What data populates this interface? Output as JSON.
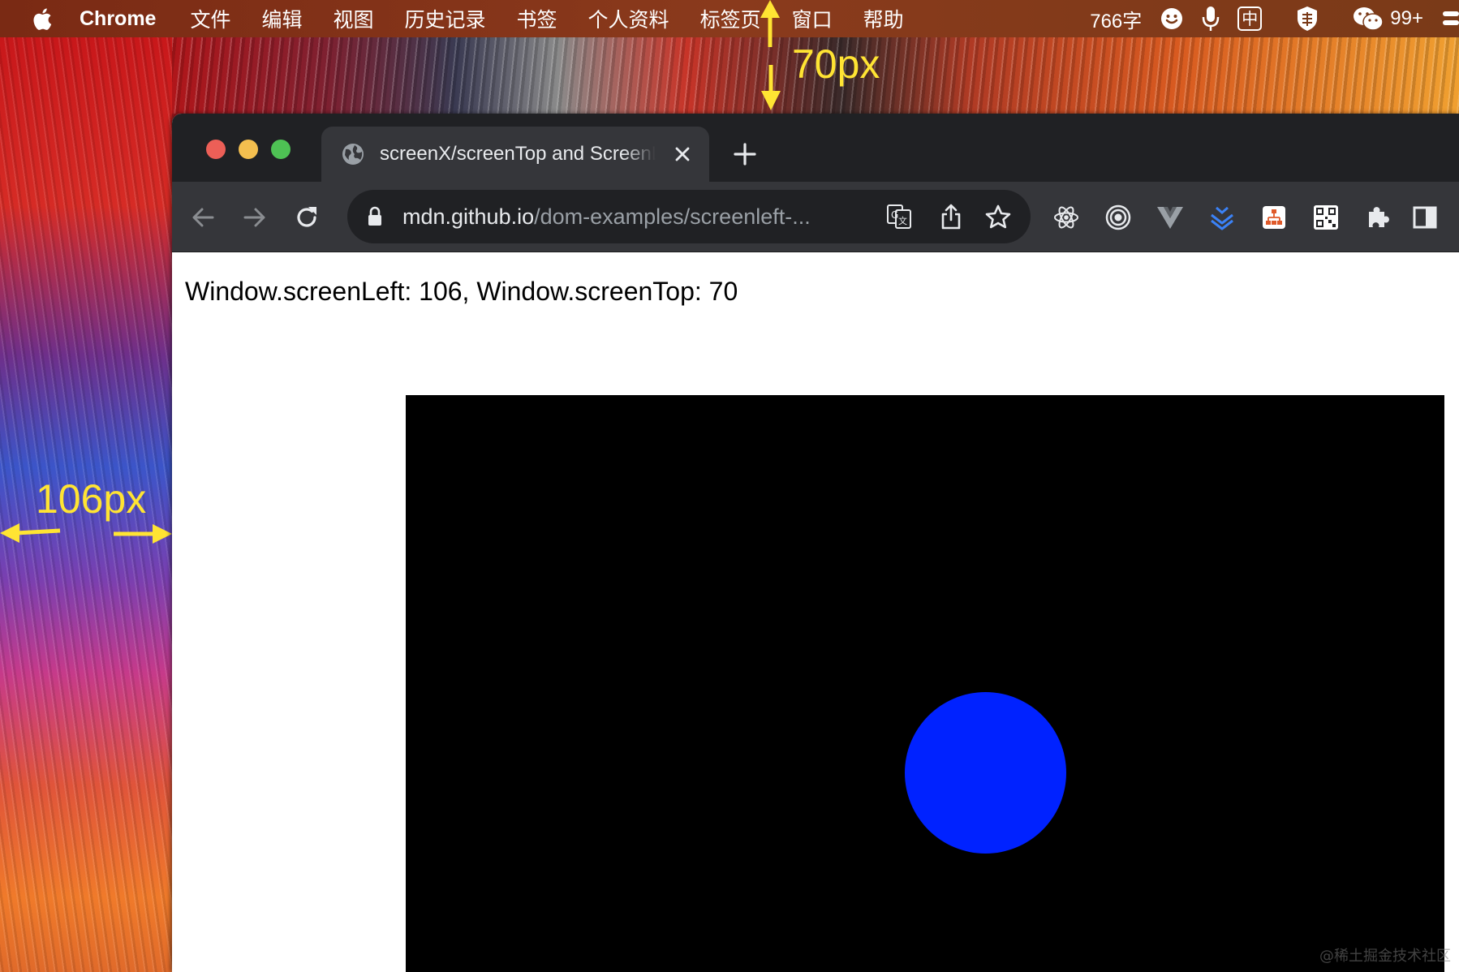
{
  "menubar": {
    "app_name": "Chrome",
    "items": [
      "文件",
      "编辑",
      "视图",
      "历史记录",
      "书签",
      "个人资料",
      "标签页",
      "窗口",
      "帮助"
    ],
    "word_count": "766字",
    "ime_label": "中",
    "wechat_badge": "99+"
  },
  "annotations": {
    "top_gap": "70px",
    "left_gap": "106px",
    "color": "#ffe433"
  },
  "browser": {
    "tab": {
      "title": "screenX/screenTop and ScreenLeft",
      "icon": "globe-icon"
    },
    "address": {
      "host": "mdn.github.io",
      "path": "/dom-examples/screenleft-..."
    },
    "extensions": [
      "react-devtools-icon",
      "target-icon",
      "vue-devtools-icon",
      "layers-icon",
      "sitemap-icon",
      "qr-code-icon",
      "puzzle-icon",
      "side-panel-icon"
    ]
  },
  "page": {
    "screen_left_label": "Window.screenLeft:",
    "screen_left_value": "106",
    "screen_top_label": "Window.screenTop:",
    "screen_top_value": "70",
    "canvas_color": "#000000",
    "ball_color": "#0022ff"
  },
  "watermark": "@稀土掘金技术社区"
}
